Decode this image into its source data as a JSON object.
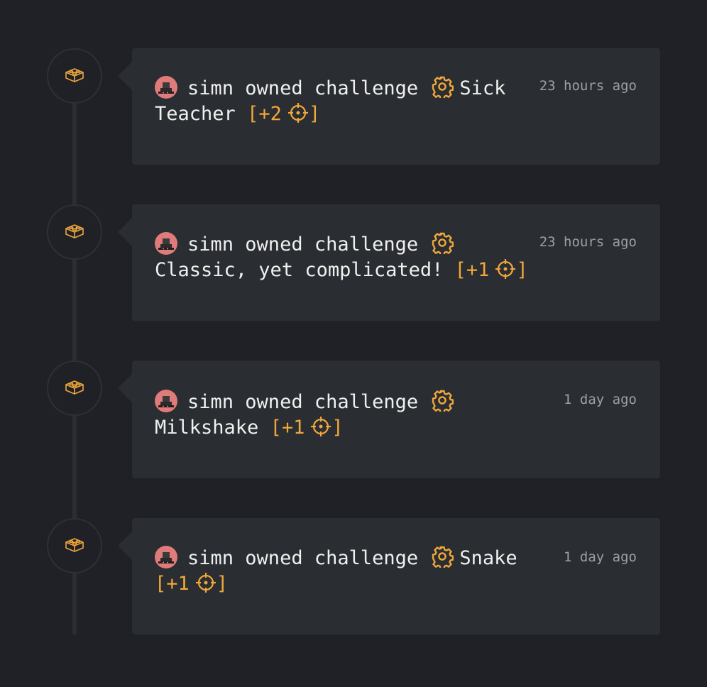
{
  "colors": {
    "background": "#1f2126",
    "card": "#2a2d31",
    "accent": "#f0a73c",
    "text": "#f0f0f0",
    "muted": "#9aa0a6",
    "avatar": "#e07b7b"
  },
  "events": [
    {
      "user": "simn",
      "action": "owned challenge",
      "challenge_icon": "gear-icon",
      "challenge": "Sick Teacher",
      "points_open": "[",
      "points": "+2",
      "points_close": "]",
      "time": "23 hours ago",
      "node_icon": "lego-brick-icon"
    },
    {
      "user": "simn",
      "action": "owned challenge",
      "challenge_icon": "gear-icon",
      "challenge": "Classic, yet complicated!",
      "points_open": "[",
      "points": "+1",
      "points_close": "]",
      "time": "23 hours ago",
      "node_icon": "lego-brick-icon"
    },
    {
      "user": "simn",
      "action": "owned challenge",
      "challenge_icon": "gear-icon",
      "challenge": "Milkshake",
      "points_open": "[",
      "points": "+1",
      "points_close": "]",
      "time": "1 day ago",
      "node_icon": "lego-brick-icon"
    },
    {
      "user": "simn",
      "action": "owned challenge",
      "challenge_icon": "gear-icon",
      "challenge": "Snake",
      "points_open": "[",
      "points": "+1",
      "points_close": "]",
      "time": "1 day ago",
      "node_icon": "lego-brick-icon"
    }
  ]
}
